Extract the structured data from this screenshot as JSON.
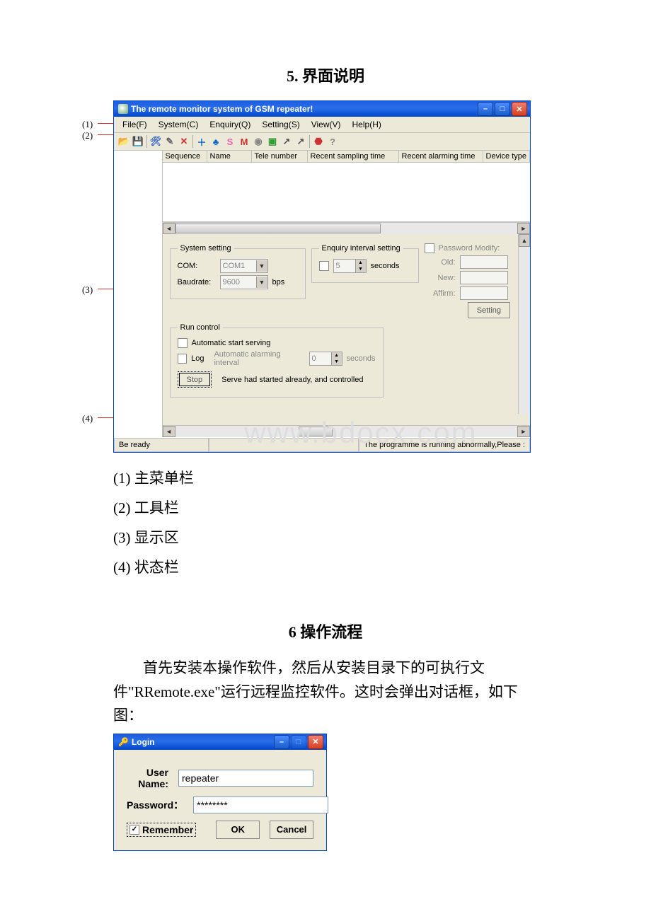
{
  "headings": {
    "section5": "5. 界面说明",
    "section6": "6 操作流程"
  },
  "callouts": {
    "c1": "(1)",
    "c2": "(2)",
    "c3": "(3)",
    "c4": "(4)"
  },
  "xp": {
    "title": "The remote monitor system of GSM repeater!",
    "menu": {
      "file": "File(F)",
      "system": "System(C)",
      "enquiry": "Enquiry(Q)",
      "setting": "Setting(S)",
      "view": "View(V)",
      "help": "Help(H)"
    },
    "list_headers": {
      "sequence": "Sequence",
      "name": "Name",
      "tele": "Tele number",
      "recent_sampling": "Recent sampling time",
      "recent_alarming": "Recent alarming time",
      "device_type": "Device type"
    },
    "system_setting": {
      "legend": "System setting",
      "com_label": "COM:",
      "com_value": "COM1",
      "baud_label": "Baudrate:",
      "baud_value": "9600",
      "baud_unit": "bps"
    },
    "enquiry_interval": {
      "legend": "Enquiry interval setting",
      "value": "5",
      "unit": "seconds"
    },
    "password": {
      "check_label": "Password Modify:",
      "old": "Old:",
      "new": "New:",
      "affirm": "Affirm:",
      "button": "Setting"
    },
    "run_control": {
      "legend": "Run control",
      "auto_start": "Automatic start serving",
      "log": "Log",
      "alarm_interval_label": "Automatic alarming interval",
      "alarm_value": "0",
      "alarm_unit": "seconds",
      "stop": "Stop",
      "status": "Serve had started already, and controlled"
    },
    "statusbar": {
      "left": "Be ready",
      "right": "The programme is running abnormally,Please :"
    },
    "win_btns": {
      "min": "–",
      "max": "□",
      "close": "✕"
    }
  },
  "legend_list": {
    "l1": "(1) 主菜单栏",
    "l2": "(2) 工具栏",
    "l3": "(3) 显示区",
    "l4": "(4) 状态栏"
  },
  "body_text": "首先安装本操作软件，然后从安装目录下的可执行文件\"RRemote.exe\"运行远程监控软件。这时会弹出对话框，如下图：",
  "login": {
    "title": "Login",
    "user_label": "User Name:",
    "user_value": "repeater",
    "pass_label": "Password：",
    "pass_value": "********",
    "remember": "Remember",
    "ok": "OK",
    "cancel": "Cancel"
  },
  "watermark": "www.bdocx.com"
}
